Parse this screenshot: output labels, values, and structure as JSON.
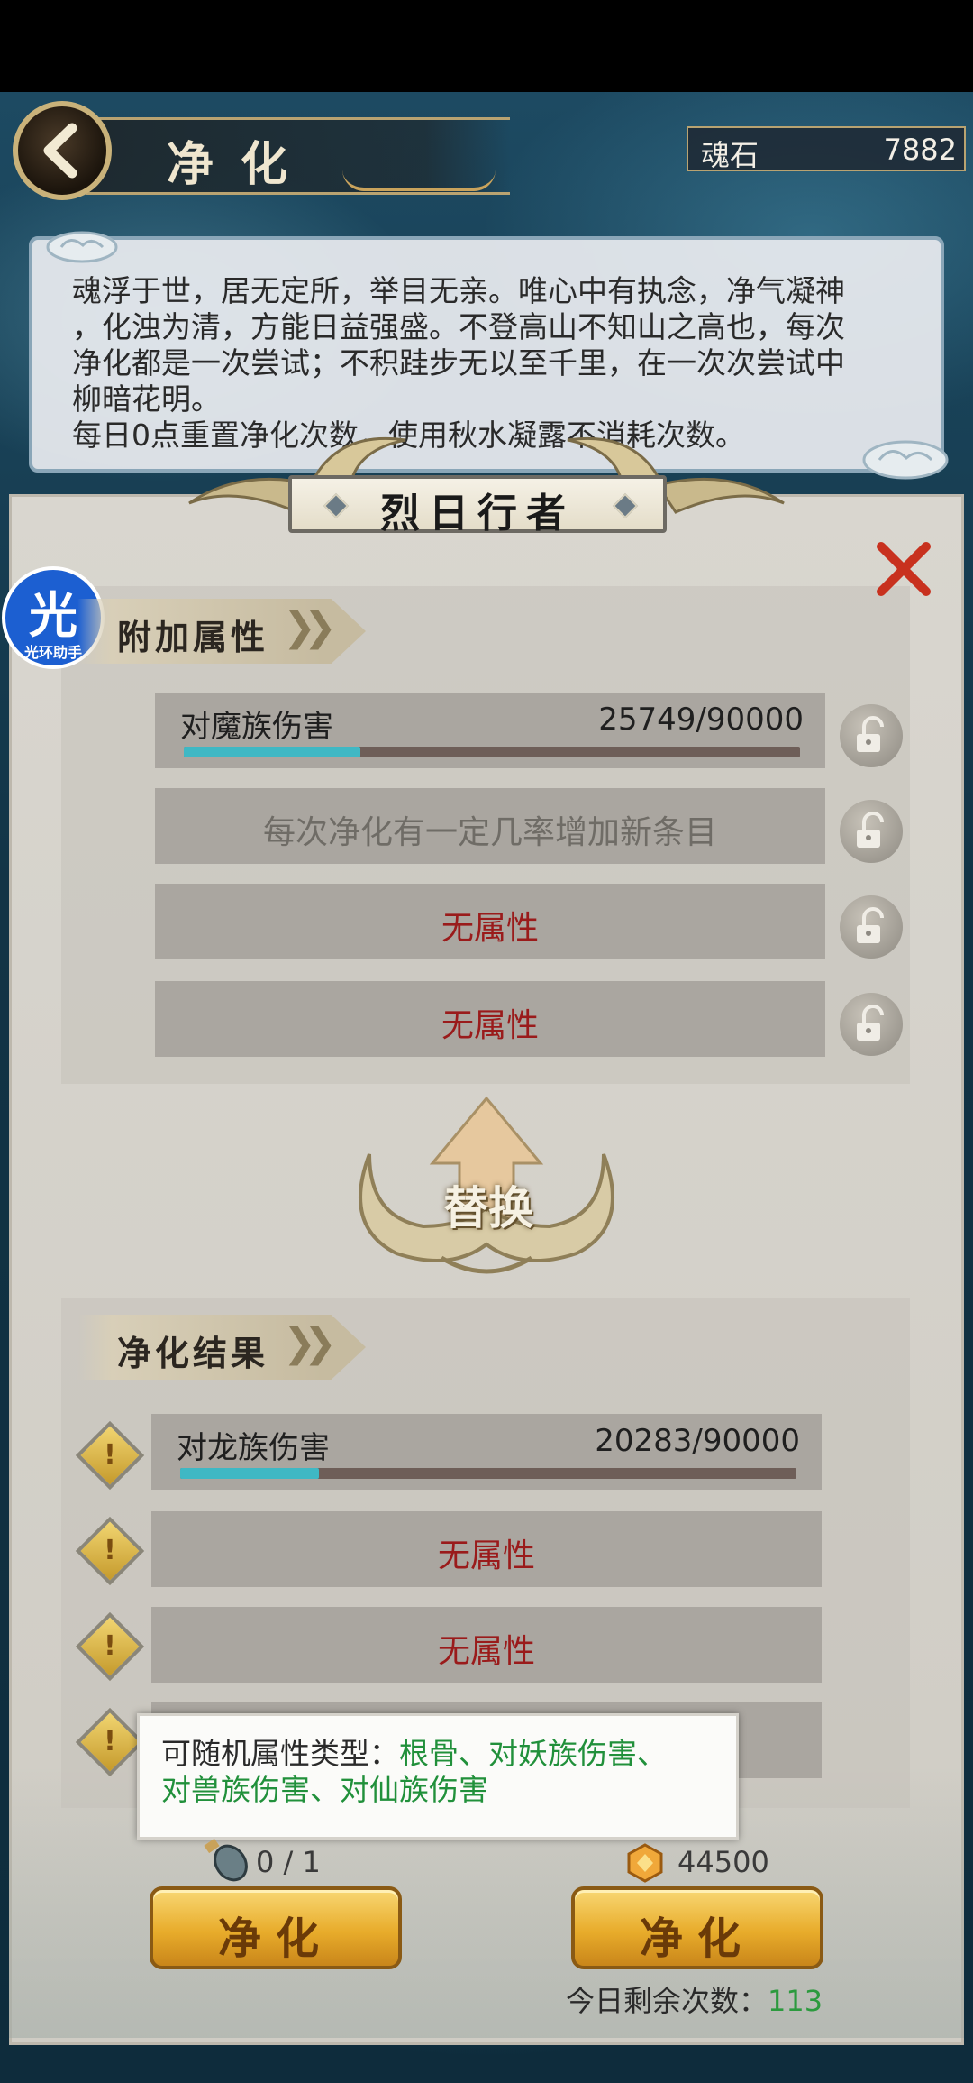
{
  "header": {
    "title": "净化",
    "currency_label": "魂石",
    "currency_value": "7882"
  },
  "description": {
    "lines": [
      "魂浮于世，居无定所，举目无亲。唯心中有执念，净气凝神",
      "，化浊为清，方能日益强盛。不登高山不知山之高也，每次",
      "净化都是一次尝试；不积跬步无以至千里，在一次次尝试中",
      "柳暗花明。",
      "每日0点重置净化次数，使用秋水凝露不消耗次数。"
    ]
  },
  "item_name": "烈日行者",
  "logo": {
    "big": "光",
    "small": "光环助手"
  },
  "attached": {
    "section_label": "附加属性",
    "rows": [
      {
        "name": "对魔族伤害",
        "value": "25749/90000",
        "progress": 0.286
      },
      {
        "text": "每次净化有一定几率增加新条目"
      },
      {
        "text": "无属性"
      },
      {
        "text": "无属性"
      }
    ]
  },
  "replace_label": "替换",
  "result": {
    "section_label": "净化结果",
    "rows": [
      {
        "name": "对龙族伤害",
        "value": "20283/90000",
        "progress": 0.225
      },
      {
        "text": "无属性"
      },
      {
        "text": "无属性"
      }
    ]
  },
  "tooltip": {
    "label": "可随机属性类型：",
    "types_line1": "根骨、对妖族伤害、",
    "types_line2": "对兽族伤害、对仙族伤害"
  },
  "bottom": {
    "item_count": "0 / 1",
    "coin_value": "44500",
    "button_left": "净化",
    "button_right": "净化",
    "remain_label": "今日剩余次数：",
    "remain_value": "113"
  },
  "colors": {
    "progress_fill": "#3fb8c4",
    "no_attr_red": "#9a1b1b",
    "remain_green": "#2c9a3e",
    "tooltip_green": "#21903b"
  },
  "icons": [
    "back-arrow-icon",
    "close-icon",
    "lock-icon",
    "warning-icon",
    "bottle-icon",
    "coin-icon",
    "up-arrow-icon"
  ]
}
